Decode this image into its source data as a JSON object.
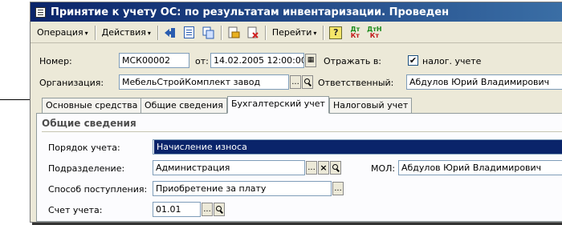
{
  "window": {
    "title": "Принятие к учету ОС: по результатам инвентаризации. Проведен"
  },
  "toolbar": {
    "operation_label": "Операция",
    "actions_label": "Действия",
    "goto_label": "Перейти",
    "help_glyph": "?",
    "dtkt_top": "Дт",
    "dtkt_bottom": "Кт",
    "dtkt2_top": "ДтН",
    "dtkt2_bottom": "Кт",
    "arrow_glyph": "▾"
  },
  "header": {
    "number_label": "Номер:",
    "number_value": "МСК00002",
    "date_label": "от:",
    "date_value": "14.02.2005 12:00:00",
    "reflect_label": "Отражать в:",
    "tax_checkbox_label": "налог. учете",
    "tax_checked": "✔",
    "org_label": "Организация:",
    "org_value": "МебельСтройКомплект завод",
    "responsible_label": "Ответственный:",
    "responsible_value": "Абдулов Юрий Владимирович"
  },
  "tabs": [
    {
      "label": "Основные средства"
    },
    {
      "label": "Общие сведения"
    },
    {
      "label": "Бухгалтерский учет"
    },
    {
      "label": "Налоговый учет"
    }
  ],
  "panel": {
    "section_title": "Общие сведения",
    "order_label": "Порядок учета:",
    "order_value": "Начисление износа",
    "dept_label": "Подразделение:",
    "dept_value": "Администрация",
    "mol_label": "МОЛ:",
    "mol_value": "Абдулов Юрий Владимирович",
    "receipt_label": "Способ поступления:",
    "receipt_value": "Приобретение за плату",
    "account_label": "Счет учета:",
    "account_value": "01.01"
  },
  "buttons": {
    "ellipsis": "...",
    "clear": "×",
    "calendar": "▦"
  },
  "colors": {
    "titlebar": "#0a246a",
    "selection": "#0a246a"
  }
}
